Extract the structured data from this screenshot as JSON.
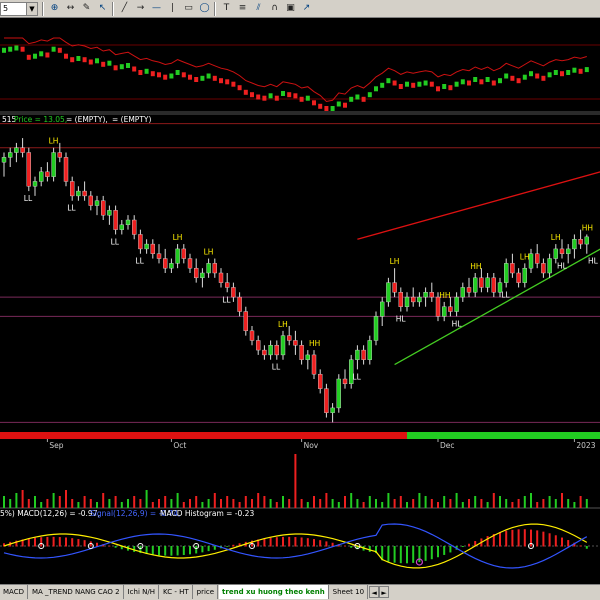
{
  "toolbar": {
    "combo_value": "5",
    "icons": [
      "zoom-icon",
      "scroll-icon",
      "draw-icon",
      "select-icon",
      "line-icon",
      "ray-icon",
      "hline-icon",
      "vline-icon",
      "rect-icon",
      "ellipse-icon",
      "text-icon",
      "fib-icon",
      "channel-icon",
      "magnet-icon",
      "lock-icon",
      "pointer-icon"
    ]
  },
  "colors": {
    "bull": "#22cc22",
    "bear": "#ee2020",
    "resistance": "#dd1111",
    "support": "#44cc22",
    "grid": "#333333"
  },
  "top_panel": {},
  "price_panel": {
    "header": {
      "ticker": "515",
      "price_text": "Price = 13.05,",
      "empty1": " = (EMPTY),",
      "empty2": " = (EMPTY)"
    },
    "labels": [
      {
        "text": "LH",
        "kind": "high",
        "i": 8
      },
      {
        "text": "LL",
        "kind": "low",
        "i": 4
      },
      {
        "text": "LL",
        "kind": "low",
        "i": 11
      },
      {
        "text": "LL",
        "kind": "low",
        "i": 18
      },
      {
        "text": "LH",
        "kind": "high",
        "i": 28
      },
      {
        "text": "LL",
        "kind": "low",
        "i": 22
      },
      {
        "text": "LH",
        "kind": "high",
        "i": 33
      },
      {
        "text": "LL",
        "kind": "low",
        "i": 36
      },
      {
        "text": "LH",
        "kind": "high",
        "i": 45
      },
      {
        "text": "HH",
        "kind": "high",
        "i": 50
      },
      {
        "text": "LL",
        "kind": "low",
        "i": 44
      },
      {
        "text": "LL",
        "kind": "low",
        "i": 57
      },
      {
        "text": "HL",
        "kind": "low",
        "i": 64
      },
      {
        "text": "LH",
        "kind": "high",
        "i": 63
      },
      {
        "text": "HH",
        "kind": "high",
        "i": 71
      },
      {
        "text": "HL",
        "kind": "low",
        "i": 73
      },
      {
        "text": "HH",
        "kind": "high",
        "i": 76
      },
      {
        "text": "LL",
        "kind": "low",
        "i": 81
      },
      {
        "text": "LH",
        "kind": "high",
        "i": 84
      },
      {
        "text": "LH",
        "kind": "high",
        "i": 89
      },
      {
        "text": "HL",
        "kind": "low",
        "i": 90
      },
      {
        "text": "HH",
        "kind": "high",
        "i": 94
      },
      {
        "text": "HL",
        "kind": "low",
        "i": 95
      },
      {
        "text": "LH",
        "kind": "high",
        "i": 98
      }
    ]
  },
  "time_axis": {
    "labels": [
      {
        "text": "Sep",
        "i": 7
      },
      {
        "text": "Oct",
        "i": 27
      },
      {
        "text": "Nov",
        "i": 48
      },
      {
        "text": "Dec",
        "i": 70
      },
      {
        "text": "2023",
        "i": 92
      }
    ]
  },
  "volume_panel": {},
  "macd_panel": {
    "header": {
      "part1": "5%) MACD(12,26) = -0.97,",
      "part2": "Signal(12,26,9) = -0.74,",
      "part3": "MACD Histogram = -0.23"
    }
  },
  "tabs": [
    {
      "label": "MACD"
    },
    {
      "label": "MA _TREND NANG CAO 2"
    },
    {
      "label": "Ichi N/H"
    },
    {
      "label": "KC - HT"
    },
    {
      "label": "price"
    },
    {
      "label": "trend xu huong theo kenh",
      "active": true
    },
    {
      "label": "Sheet 10"
    }
  ],
  "chart_data": {
    "type": "candlestick",
    "description_units": "price",
    "ohlc": [
      [
        14.6,
        14.8,
        14.3,
        14.7
      ],
      [
        14.7,
        14.9,
        14.5,
        14.8
      ],
      [
        14.8,
        15.0,
        14.6,
        14.9
      ],
      [
        14.9,
        15.1,
        14.7,
        14.8
      ],
      [
        14.8,
        14.9,
        14.0,
        14.1
      ],
      [
        14.1,
        14.3,
        13.9,
        14.2
      ],
      [
        14.2,
        14.5,
        14.1,
        14.4
      ],
      [
        14.4,
        14.6,
        14.2,
        14.3
      ],
      [
        14.3,
        14.9,
        14.2,
        14.8
      ],
      [
        14.8,
        15.0,
        14.6,
        14.7
      ],
      [
        14.7,
        14.8,
        14.1,
        14.2
      ],
      [
        14.2,
        14.3,
        13.8,
        13.9
      ],
      [
        13.9,
        14.1,
        13.8,
        14.0
      ],
      [
        14.0,
        14.2,
        13.8,
        13.9
      ],
      [
        13.9,
        14.0,
        13.6,
        13.7
      ],
      [
        13.7,
        13.9,
        13.5,
        13.8
      ],
      [
        13.8,
        13.9,
        13.4,
        13.5
      ],
      [
        13.5,
        13.7,
        13.3,
        13.6
      ],
      [
        13.6,
        13.7,
        13.1,
        13.2
      ],
      [
        13.2,
        13.4,
        13.1,
        13.3
      ],
      [
        13.3,
        13.5,
        13.2,
        13.4
      ],
      [
        13.4,
        13.5,
        13.0,
        13.1
      ],
      [
        13.1,
        13.2,
        12.7,
        12.8
      ],
      [
        12.8,
        13.0,
        12.7,
        12.9
      ],
      [
        12.9,
        13.0,
        12.6,
        12.7
      ],
      [
        12.7,
        12.9,
        12.5,
        12.6
      ],
      [
        12.6,
        12.8,
        12.3,
        12.4
      ],
      [
        12.4,
        12.6,
        12.3,
        12.5
      ],
      [
        12.5,
        12.9,
        12.4,
        12.8
      ],
      [
        12.8,
        12.9,
        12.5,
        12.6
      ],
      [
        12.6,
        12.7,
        12.3,
        12.4
      ],
      [
        12.4,
        12.6,
        12.1,
        12.2
      ],
      [
        12.2,
        12.4,
        12.0,
        12.3
      ],
      [
        12.3,
        12.6,
        12.2,
        12.5
      ],
      [
        12.5,
        12.6,
        12.2,
        12.3
      ],
      [
        12.3,
        12.4,
        12.0,
        12.1
      ],
      [
        12.1,
        12.3,
        11.9,
        12.0
      ],
      [
        12.0,
        12.1,
        11.7,
        11.8
      ],
      [
        11.8,
        11.9,
        11.4,
        11.5
      ],
      [
        11.5,
        11.6,
        11.0,
        11.1
      ],
      [
        11.1,
        11.2,
        10.8,
        10.9
      ],
      [
        10.9,
        11.0,
        10.6,
        10.7
      ],
      [
        10.7,
        10.8,
        10.5,
        10.6
      ],
      [
        10.6,
        10.9,
        10.5,
        10.8
      ],
      [
        10.8,
        10.9,
        10.5,
        10.6
      ],
      [
        10.6,
        11.1,
        10.5,
        11.0
      ],
      [
        11.0,
        11.2,
        10.8,
        10.9
      ],
      [
        10.9,
        11.1,
        10.6,
        10.8
      ],
      [
        10.8,
        10.9,
        10.4,
        10.5
      ],
      [
        10.5,
        10.7,
        10.3,
        10.6
      ],
      [
        10.6,
        10.7,
        10.1,
        10.2
      ],
      [
        10.2,
        10.3,
        9.8,
        9.9
      ],
      [
        9.9,
        10.0,
        9.3,
        9.4
      ],
      [
        9.4,
        9.6,
        9.2,
        9.5
      ],
      [
        9.5,
        10.2,
        9.4,
        10.1
      ],
      [
        10.1,
        10.3,
        9.9,
        10.0
      ],
      [
        10.0,
        10.6,
        9.9,
        10.5
      ],
      [
        10.5,
        10.8,
        10.3,
        10.7
      ],
      [
        10.7,
        10.8,
        10.4,
        10.5
      ],
      [
        10.5,
        11.0,
        10.4,
        10.9
      ],
      [
        10.9,
        11.5,
        10.8,
        11.4
      ],
      [
        11.4,
        11.8,
        11.2,
        11.7
      ],
      [
        11.7,
        12.2,
        11.6,
        12.1
      ],
      [
        12.1,
        12.4,
        11.8,
        11.9
      ],
      [
        11.9,
        12.0,
        11.5,
        11.6
      ],
      [
        11.6,
        11.9,
        11.5,
        11.8
      ],
      [
        11.8,
        12.0,
        11.6,
        11.7
      ],
      [
        11.7,
        11.9,
        11.6,
        11.8
      ],
      [
        11.8,
        12.0,
        11.6,
        11.9
      ],
      [
        11.9,
        12.1,
        11.7,
        11.8
      ],
      [
        11.8,
        11.9,
        11.3,
        11.4
      ],
      [
        11.4,
        11.7,
        11.3,
        11.6
      ],
      [
        11.6,
        11.8,
        11.4,
        11.5
      ],
      [
        11.5,
        11.9,
        11.4,
        11.8
      ],
      [
        11.8,
        12.1,
        11.7,
        12.0
      ],
      [
        12.0,
        12.2,
        11.8,
        11.9
      ],
      [
        11.9,
        12.3,
        11.8,
        12.2
      ],
      [
        12.2,
        12.4,
        11.9,
        12.0
      ],
      [
        12.0,
        12.3,
        11.9,
        12.2
      ],
      [
        12.2,
        12.3,
        11.8,
        11.9
      ],
      [
        11.9,
        12.2,
        11.8,
        12.1
      ],
      [
        12.1,
        12.6,
        12.0,
        12.5
      ],
      [
        12.5,
        12.7,
        12.2,
        12.3
      ],
      [
        12.3,
        12.4,
        12.0,
        12.1
      ],
      [
        12.1,
        12.5,
        12.0,
        12.4
      ],
      [
        12.4,
        12.8,
        12.3,
        12.7
      ],
      [
        12.7,
        12.9,
        12.4,
        12.5
      ],
      [
        12.5,
        12.6,
        12.2,
        12.3
      ],
      [
        12.3,
        12.7,
        12.2,
        12.6
      ],
      [
        12.6,
        12.9,
        12.5,
        12.8
      ],
      [
        12.8,
        13.0,
        12.6,
        12.7
      ],
      [
        12.7,
        12.9,
        12.5,
        12.8
      ],
      [
        12.8,
        13.1,
        12.6,
        13.0
      ],
      [
        13.0,
        13.2,
        12.8,
        12.9
      ],
      [
        12.9,
        13.1,
        12.7,
        13.05
      ]
    ],
    "volume": [
      4,
      3,
      5,
      6,
      3,
      4,
      2,
      3,
      5,
      4,
      6,
      3,
      2,
      4,
      3,
      2,
      5,
      3,
      4,
      2,
      3,
      4,
      3,
      6,
      2,
      3,
      4,
      3,
      5,
      2,
      3,
      4,
      2,
      3,
      5,
      3,
      4,
      3,
      2,
      4,
      3,
      5,
      4,
      3,
      2,
      4,
      3,
      18,
      3,
      2,
      4,
      3,
      5,
      3,
      2,
      4,
      5,
      3,
      2,
      4,
      3,
      2,
      5,
      3,
      4,
      2,
      3,
      5,
      4,
      3,
      2,
      4,
      3,
      5,
      2,
      3,
      4,
      3,
      2,
      5,
      4,
      3,
      2,
      3,
      4,
      5,
      2,
      3,
      4,
      3,
      5,
      3,
      2,
      4,
      3,
      4,
      5,
      3,
      2,
      4
    ],
    "macd": {
      "macd": -0.97,
      "signal": -0.74,
      "histogram": -0.23
    },
    "trendlines": [
      {
        "name": "resistance",
        "from": [
          57,
          13.0
        ],
        "to": [
          99,
          14.5
        ]
      },
      {
        "name": "support",
        "from": [
          63,
          10.4
        ],
        "to": [
          99,
          13.0
        ]
      }
    ],
    "y_range": [
      9.0,
      15.6
    ]
  }
}
